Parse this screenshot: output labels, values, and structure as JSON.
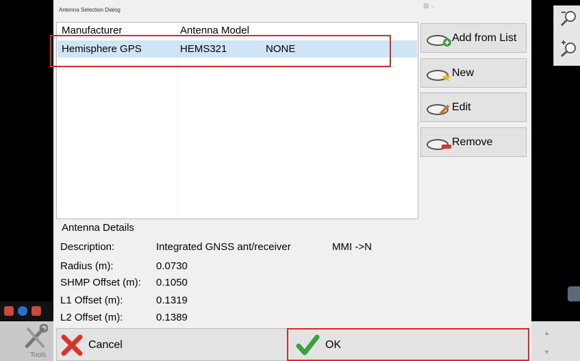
{
  "dialog": {
    "title": "Antenna Selection Dialog"
  },
  "list": {
    "columns": [
      "Manufacturer",
      "Antenna Model"
    ],
    "rows": [
      {
        "manufacturer": "Hemisphere GPS",
        "model": "HEMS321",
        "extra": "NONE"
      }
    ]
  },
  "buttons": {
    "add_from_list": "Add from List",
    "new": "New",
    "edit": "Edit",
    "remove": "Remove",
    "cancel": "Cancel",
    "ok": "OK"
  },
  "details": {
    "title": "Antenna Details",
    "fields": [
      {
        "label": "Description:",
        "value": "Integrated GNSS ant/receiver"
      },
      {
        "label": "Radius (m):",
        "value": "0.0730"
      },
      {
        "label": "SHMP Offset (m):",
        "value": "0.1050"
      },
      {
        "label": "L1 Offset (m):",
        "value": "0.1319"
      },
      {
        "label": "L2 Offset (m):",
        "value": "0.1389"
      }
    ],
    "extra": "MMI ->N"
  },
  "sidebar": {
    "tools_label": "Tools"
  },
  "icons": {
    "zoom_out": "zoom-out-icon",
    "zoom_in": "zoom-in-icon",
    "add": "add-from-list-icon",
    "new": "new-icon",
    "edit": "edit-icon",
    "remove": "remove-icon",
    "cancel": "cancel-x-icon",
    "ok": "ok-check-icon",
    "tools": "tools-icon"
  },
  "colors": {
    "selection": "#cfe4f5",
    "highlight": "#d42b2b",
    "ok_green": "#3aa33a",
    "cancel_red": "#d9342b"
  }
}
